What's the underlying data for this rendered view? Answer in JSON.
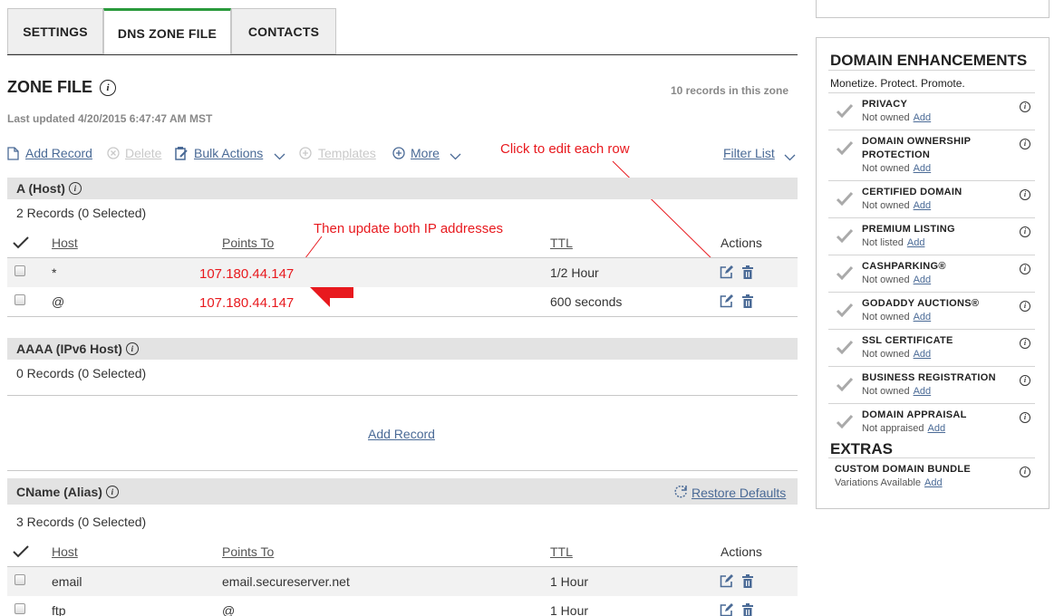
{
  "tabs": [
    {
      "label": "SETTINGS"
    },
    {
      "label": "DNS ZONE FILE"
    },
    {
      "label": "CONTACTS"
    }
  ],
  "zone": {
    "title": "ZONE FILE",
    "record_count": "10 records in this zone",
    "last_updated": "Last updated 4/20/2015 6:47:47 AM MST"
  },
  "toolbar": {
    "add_record": "Add Record",
    "delete": "Delete",
    "bulk_actions": "Bulk Actions",
    "templates": "Templates",
    "more": "More",
    "filter_list": "Filter List"
  },
  "annotations": {
    "edit_hint": "Click to edit each row",
    "update_hint": "Then update both IP addresses"
  },
  "a_section": {
    "title": "A (Host)",
    "summary": "2 Records (0 Selected)",
    "headers": {
      "host": "Host",
      "points_to": "Points To",
      "ttl": "TTL",
      "actions": "Actions"
    },
    "rows": [
      {
        "host": "*",
        "points_to": "107.180.44.147",
        "ttl": "1/2 Hour"
      },
      {
        "host": "@",
        "points_to": "107.180.44.147",
        "ttl": "600 seconds"
      }
    ]
  },
  "aaaa_section": {
    "title": "AAAA (IPv6 Host)",
    "summary": "0 Records (0 Selected)",
    "add_record": "Add Record"
  },
  "cname_section": {
    "title": "CName (Alias)",
    "restore": "Restore Defaults",
    "summary": "3 Records (0 Selected)",
    "headers": {
      "host": "Host",
      "points_to": "Points To",
      "ttl": "TTL",
      "actions": "Actions"
    },
    "rows": [
      {
        "host": "email",
        "points_to": "email.secureserver.net",
        "ttl": "1 Hour"
      },
      {
        "host": "ftp",
        "points_to": "@",
        "ttl": "1 Hour"
      }
    ]
  },
  "sidebar": {
    "title": "DOMAIN ENHANCEMENTS",
    "subtitle": "Monetize. Protect. Promote.",
    "items": [
      {
        "name": "PRIVACY",
        "status": "Not owned",
        "action": "Add"
      },
      {
        "name": "DOMAIN OWNERSHIP PROTECTION",
        "status": "Not owned",
        "action": "Add"
      },
      {
        "name": "CERTIFIED DOMAIN",
        "status": "Not owned",
        "action": "Add"
      },
      {
        "name": "PREMIUM LISTING",
        "status": "Not listed",
        "action": "Add"
      },
      {
        "name": "CASHPARKING®",
        "status": "Not owned",
        "action": "Add"
      },
      {
        "name": "GODADDY AUCTIONS®",
        "status": "Not owned",
        "action": "Add"
      },
      {
        "name": "SSL CERTIFICATE",
        "status": "Not owned",
        "action": "Add"
      },
      {
        "name": "BUSINESS REGISTRATION",
        "status": "Not owned",
        "action": "Add"
      },
      {
        "name": "DOMAIN APPRAISAL",
        "status": "Not appraised",
        "action": "Add"
      }
    ],
    "extras_title": "EXTRAS",
    "extras": [
      {
        "name": "CUSTOM DOMAIN BUNDLE",
        "status": "Variations Available",
        "action": "Add"
      }
    ]
  },
  "colors": {
    "accent": "#2a9a3c",
    "link": "#4a6a96",
    "annotation": "#e8191e"
  }
}
